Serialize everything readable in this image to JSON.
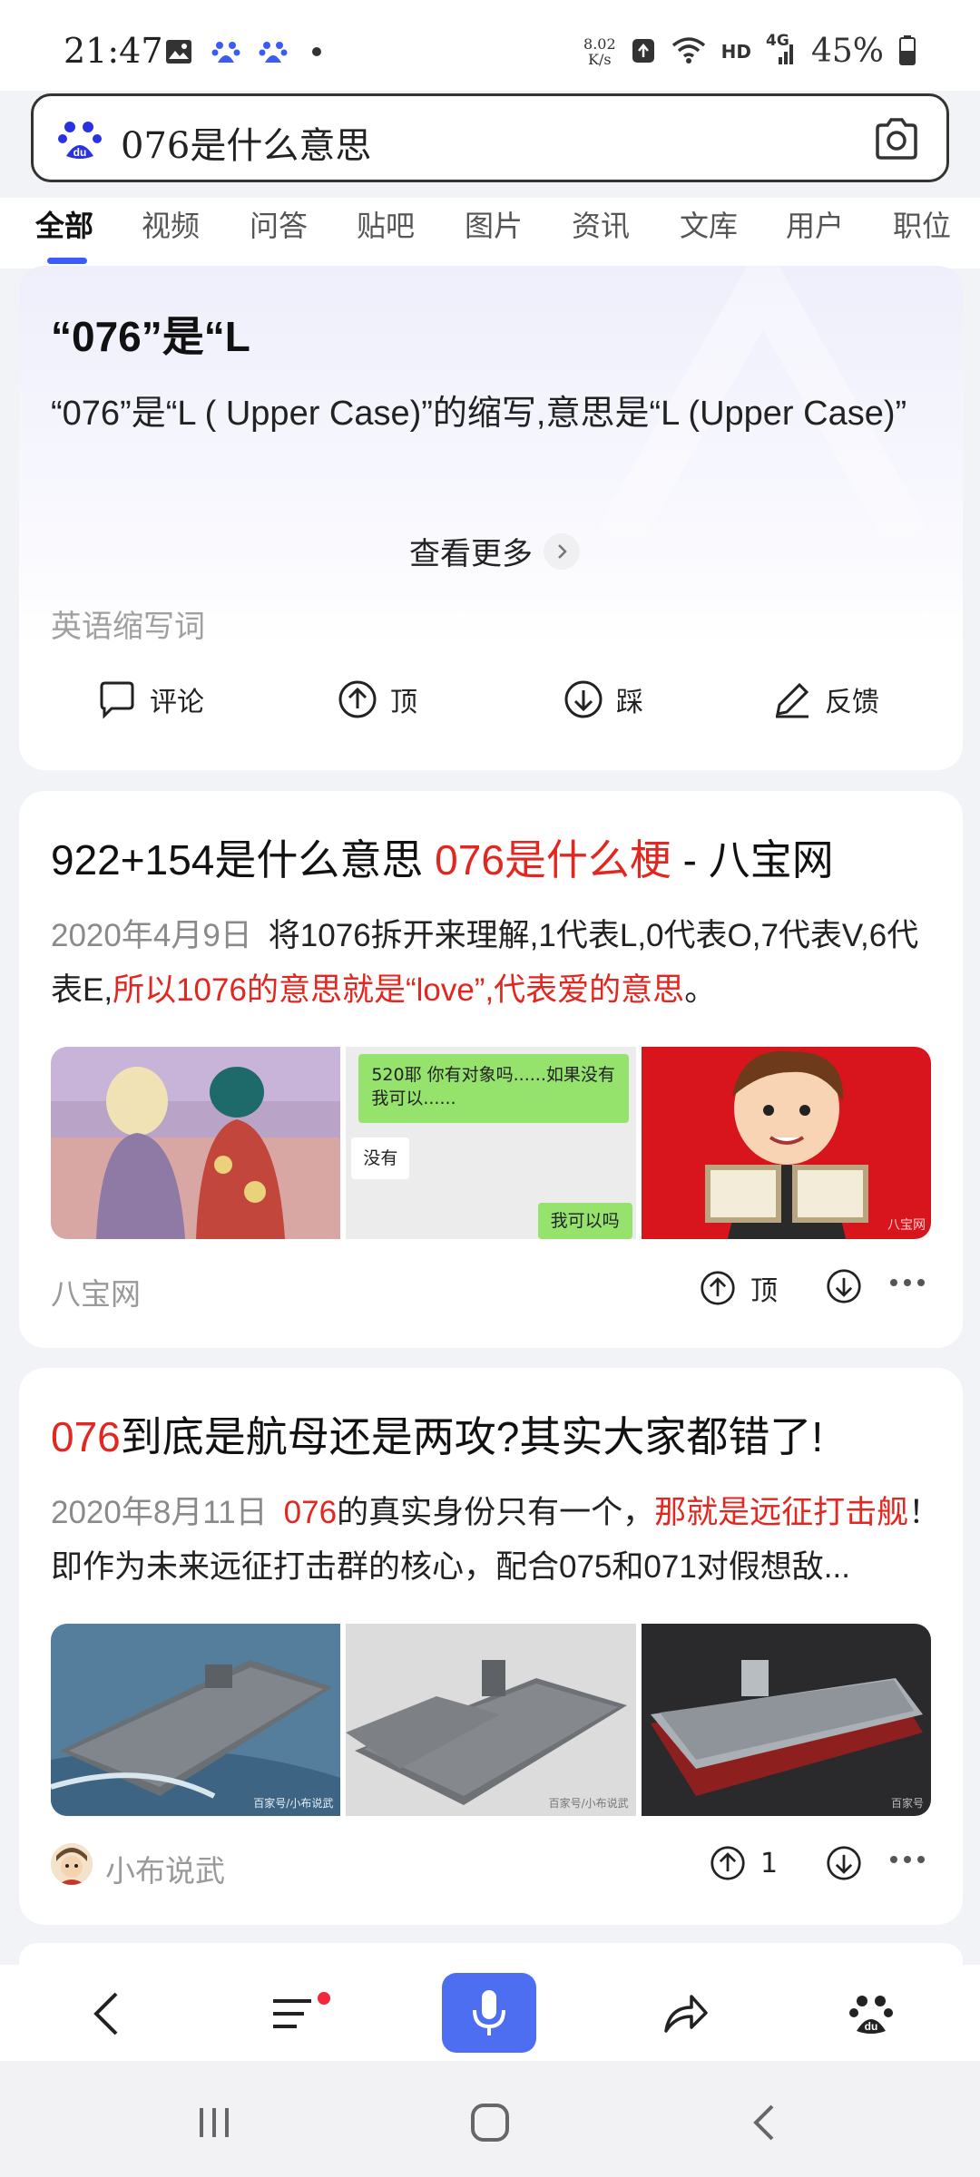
{
  "status_bar": {
    "time": "21:47",
    "net_speed_value": "8.02",
    "net_speed_unit": "K/s",
    "hd": "HD",
    "signal": "4G",
    "battery": "45%"
  },
  "search": {
    "query": "076是什么意思"
  },
  "tabs": [
    "全部",
    "视频",
    "问答",
    "贴吧",
    "图片",
    "资讯",
    "文库",
    "用户",
    "职位"
  ],
  "answer_card": {
    "title": "“076”是“L",
    "body": "“076”是“L ( Upper Case)”的缩写,意思是“L (Upper Case)”",
    "more_label": "查看更多",
    "tag": "英语缩写词",
    "actions": {
      "comment": "评论",
      "up": "顶",
      "down": "踩",
      "feedback": "反馈"
    }
  },
  "result1": {
    "title_plain": "922+154是什么意思 ",
    "title_red": "076是什么梗",
    "title_suffix": " - 八宝网",
    "date": "2020年4月9日",
    "abstract_plain": "将1076拆开来理解,1代表L,0代表O,7代表V,6代表E,",
    "abstract_red": "所以1076的意思就是“love”,代表爱的意思",
    "abstract_end": "。",
    "image2_line1": "520耶  你有对象吗......如果没有",
    "image2_line2": "我可以......",
    "image2_reply": "没有",
    "image2_ask": "我可以吗",
    "image3_watermark": "八宝网",
    "source": "八宝网",
    "up_label": "顶"
  },
  "result2": {
    "title_red": "076",
    "title_plain": "到底是航母还是两攻?其实大家都错了!",
    "date": "2020年8月11日",
    "abs_red1": "076",
    "abs_plain1": "的真实身份只有一个，",
    "abs_red2": "那就是远征打击舰",
    "abs_plain2": "！即作为未来远征打击群的核心，配合075和071对假想敌...",
    "watermark1": "百家号/小布说武",
    "watermark2": "百家号/小布说武",
    "watermark3": "百家号",
    "source": "小布说武",
    "up_count": "1"
  },
  "colors": {
    "accent": "#4e6ef2",
    "tab_underline": "#3b5bfd",
    "highlight_red": "#e3261f"
  }
}
